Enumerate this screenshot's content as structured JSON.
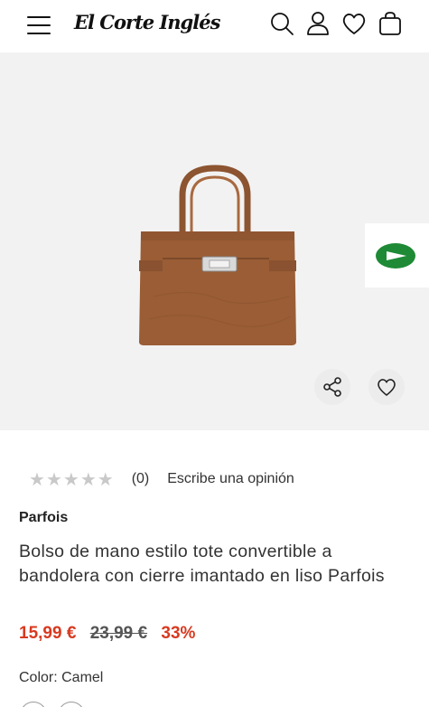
{
  "header": {
    "logo_text": "El Corte Inglés",
    "icons": [
      "menu-icon",
      "search-icon",
      "user-icon",
      "heart-icon",
      "bag-icon"
    ]
  },
  "gallery": {
    "image_alt": "Bolso de mano estilo tote convertible a bandolera con cierre imantado en liso Parfois",
    "progress_fraction": 0.25,
    "bag_color": "#9a5d35",
    "promo_color": "#1e8a35"
  },
  "rating": {
    "stars": 0,
    "count": "(0)",
    "review_link": "Escribe una opinión"
  },
  "product": {
    "brand": "Parfois",
    "title": "Bolso de mano estilo tote convertible a bandolera con cierre imantado en liso Parfois",
    "price_current": "15,99 €",
    "price_old": "23,99 €",
    "discount": "33%",
    "color_label": "Color: Camel"
  },
  "colors": {
    "accent_red": "#d83a20",
    "star_empty": "#c9c9c9"
  }
}
